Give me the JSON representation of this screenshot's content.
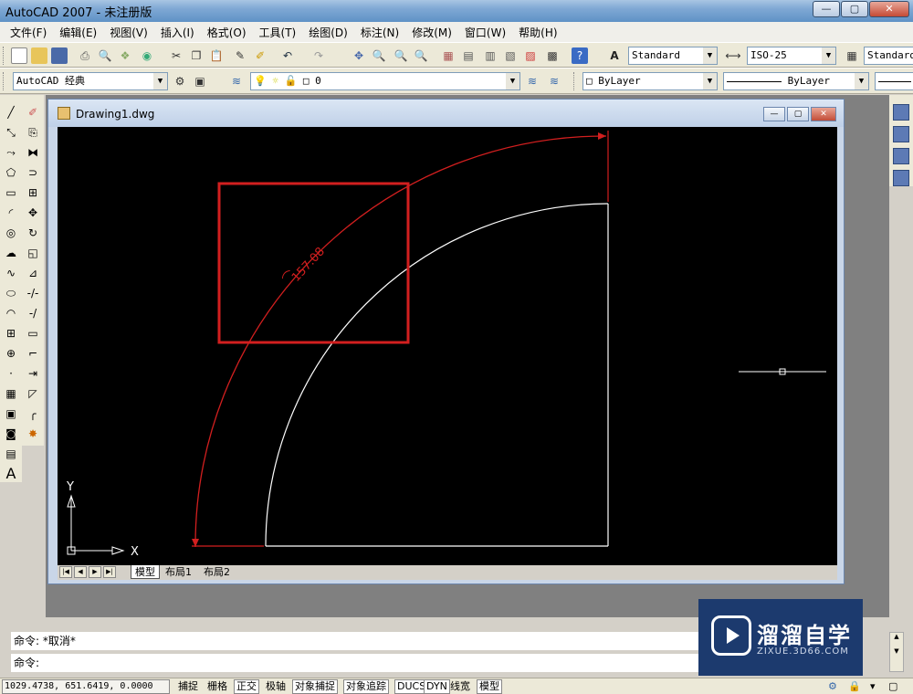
{
  "app": {
    "title": "AutoCAD 2007 - 未注册版"
  },
  "window_controls": {
    "minimize": "—",
    "maximize": "▢",
    "close": "✕"
  },
  "menu": [
    "文件(F)",
    "编辑(E)",
    "视图(V)",
    "插入(I)",
    "格式(O)",
    "工具(T)",
    "绘图(D)",
    "标注(N)",
    "修改(M)",
    "窗口(W)",
    "帮助(H)"
  ],
  "toolbar": {
    "text_style": "Standard",
    "dim_style": "ISO-25",
    "table_style": "Standard",
    "workspace": "AutoCAD 经典",
    "layer": "0",
    "color": "ByLayer",
    "linetype": "ByLayer"
  },
  "drawing": {
    "title": "Drawing1.dwg",
    "dimension_text": "157.08",
    "axis_y": "Y",
    "axis_x": "X",
    "colors": {
      "dimension": "#d21f1f",
      "geometry": "#ffffff",
      "highlight_box": "#d21f1f",
      "background": "#000000"
    }
  },
  "tabs": {
    "items": [
      "模型",
      "布局1",
      "布局2"
    ],
    "active": "模型"
  },
  "command": {
    "history": "命令: *取消*",
    "prompt": "命令:"
  },
  "status": {
    "coords": "1029.4738, 651.6419, 0.0000",
    "buttons": [
      "捕捉",
      "栅格",
      "正交",
      "极轴",
      "对象捕捉",
      "对象追踪",
      "DUCS",
      "DYN",
      "线宽",
      "模型"
    ]
  },
  "watermark": {
    "name": "溜溜自学",
    "url": "ZIXUE.3D66.COM"
  }
}
